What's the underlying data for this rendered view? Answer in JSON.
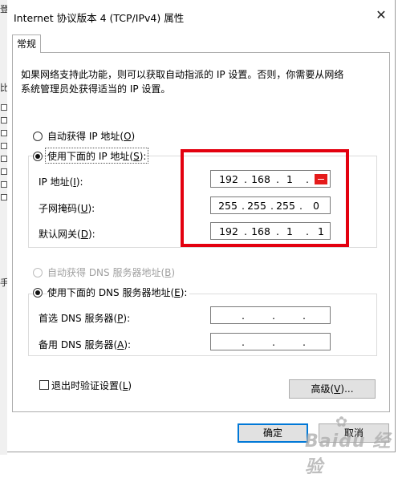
{
  "background_window": {
    "fragments": [
      "登",
      "比",
      "手"
    ]
  },
  "dialog": {
    "title": "Internet 协议版本 4 (TCP/IPv4) 属性",
    "close_icon": "close-icon",
    "tab_label": "常规",
    "description_line1": "如果网络支持此功能，则可以获取自动指派的 IP 设置。否则，你需要从网络",
    "description_line2": "系统管理员处获得适当的 IP 设置。",
    "ip_section": {
      "auto_option": {
        "prefix": "自动获得 IP 地址(",
        "key": "O",
        "suffix": ")",
        "selected": false
      },
      "manual_option": {
        "prefix": "使用下面的 IP 地址(",
        "key": "S",
        "suffix": "):",
        "selected": true
      },
      "fields": [
        {
          "prefix": "IP 地址(",
          "key": "I",
          "suffix": "):",
          "octets": [
            "192",
            "168",
            "1",
            ""
          ]
        },
        {
          "prefix": "子网掩码(",
          "key": "U",
          "suffix": "):",
          "octets": [
            "255",
            "255",
            "255",
            "0"
          ]
        },
        {
          "prefix": "默认网关(",
          "key": "D",
          "suffix": "):",
          "octets": [
            "192",
            "168",
            "1",
            "1"
          ]
        }
      ],
      "dot": "."
    },
    "dns_section": {
      "auto_option": {
        "prefix": "自动获得 DNS 服务器地址(",
        "key": "B",
        "suffix": ")",
        "enabled": false
      },
      "manual_option": {
        "prefix": "使用下面的 DNS 服务器地址(",
        "key": "E",
        "suffix": "):",
        "selected": true
      },
      "fields": [
        {
          "prefix": "首选 DNS 服务器(",
          "key": "P",
          "suffix": "):",
          "octets": [
            "",
            "",
            "",
            ""
          ]
        },
        {
          "prefix": "备用 DNS 服务器(",
          "key": "A",
          "suffix": "):",
          "octets": [
            "",
            "",
            "",
            ""
          ]
        }
      ]
    },
    "validate_checkbox": {
      "prefix": "退出时验证设置(",
      "key": "L",
      "suffix": ")",
      "checked": false
    },
    "advanced_button": {
      "prefix": "高级(",
      "key": "V",
      "suffix": ")..."
    },
    "ok_button": "确定",
    "cancel_button": "取消"
  },
  "annotation_color": "#e3000f",
  "watermark": "Baidu 经验"
}
